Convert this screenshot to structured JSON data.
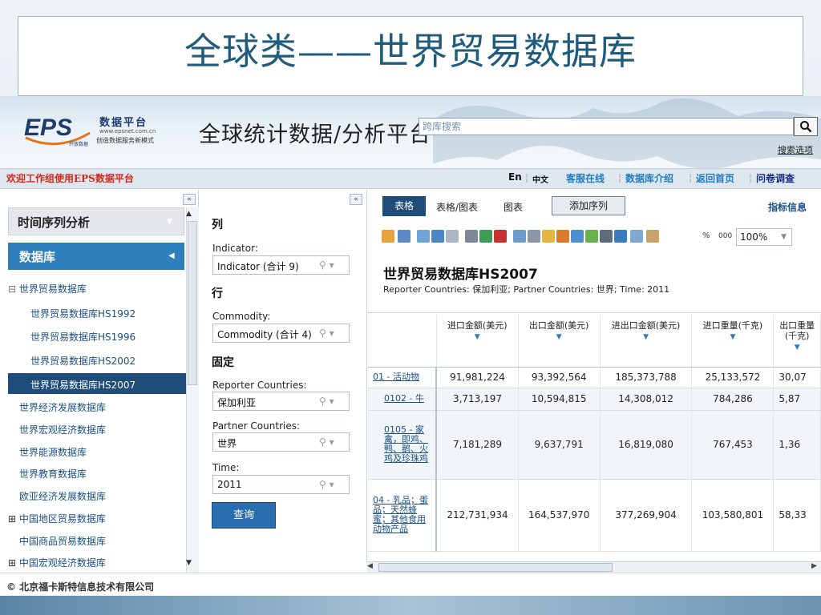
{
  "slide": {
    "title": "全球类——世界贸易数据库"
  },
  "header": {
    "logo_text": "EPS",
    "logo_subtext": "开放数据",
    "logo_tagline1": "数据平台",
    "logo_tagline2": "www.epsnet.com.cn",
    "logo_tagline3": "创造数据服务新模式",
    "slogan": "全球统计数据/分析平台",
    "search_placeholder": "跨库搜索",
    "search_options": "搜索选项"
  },
  "topnav": {
    "welcome": "欢迎工作组使用EPS数据平台",
    "links": [
      "En",
      "中文",
      "客服在线",
      "数据库介绍",
      "返回首页",
      "问卷调查"
    ]
  },
  "sidebar": {
    "collapse": "«",
    "accordion_ts": "时间序列分析",
    "accordion_db": "数据库",
    "tree": [
      {
        "label": "世界贸易数据库",
        "prefix": "⊟"
      },
      {
        "label": "世界贸易数据库HS1992"
      },
      {
        "label": "世界贸易数据库HS1996"
      },
      {
        "label": "世界贸易数据库HS2002"
      },
      {
        "label": "世界贸易数据库HS2007"
      },
      {
        "label": "世界经济发展数据库"
      },
      {
        "label": "世界宏观经济数据库"
      },
      {
        "label": "世界能源数据库"
      },
      {
        "label": "世界教育数据库"
      },
      {
        "label": "欧亚经济发展数据库"
      },
      {
        "label": "中国地区贸易数据库",
        "prefix": "⊞"
      },
      {
        "label": "中国商品贸易数据库"
      },
      {
        "label": "中国宏观经济数据库",
        "prefix": "⊞"
      }
    ]
  },
  "filters": {
    "collapse": "«",
    "col_heading": "列",
    "row_heading": "行",
    "fixed_heading": "固定",
    "indicator_label": "Indicator:",
    "indicator_value": "Indicator (合计 9)",
    "commodity_label": "Commodity:",
    "commodity_value": "Commodity (合计 4)",
    "reporter_label": "Reporter Countries:",
    "reporter_value": "保加利亚",
    "partner_label": "Partner Countries:",
    "partner_value": "世界",
    "time_label": "Time:",
    "time_value": "2011",
    "query_button": "查询"
  },
  "main": {
    "tabs": [
      "表格",
      "表格/图表",
      "图表"
    ],
    "add_series": "添加序列",
    "indicator_info": "指标信息",
    "percent": "%",
    "thousands": "000",
    "zoom": "100%",
    "table_title": "世界贸易数据库HS2007",
    "table_subtitle": "Reporter Countries: 保加利亚; Partner Countries: 世界; Time: 2011",
    "columns": [
      "进口金额(美元)",
      "出口金额(美元)",
      "进出口金额(美元)",
      "进口重量(千克)",
      "出口重量(千克)"
    ],
    "rows": [
      {
        "label": "01 - 活动物",
        "values": [
          "91,981,224",
          "93,392,564",
          "185,373,788",
          "25,133,572",
          "30,07"
        ]
      },
      {
        "label": "0102 - 牛",
        "values": [
          "3,713,197",
          "10,594,815",
          "14,308,012",
          "784,286",
          "5,87"
        ]
      },
      {
        "label": "0105 - 家禽，即鸡、鸭、鹅、火鸡及珍珠鸡",
        "values": [
          "7,181,289",
          "9,637,791",
          "16,819,080",
          "767,453",
          "1,36"
        ]
      },
      {
        "label": "04 - 乳品；蛋品；天然蜂蜜；其他食用动物产品",
        "values": [
          "212,731,934",
          "164,537,970",
          "377,269,904",
          "103,580,801",
          "58,33"
        ]
      }
    ]
  },
  "footer": {
    "copyright": "© 北京福卡斯特信息技术有限公司"
  },
  "colors": {
    "brand_blue": "#1d4d78",
    "accent_blue": "#2f7fbc",
    "welcome_red": "#d4281c"
  }
}
